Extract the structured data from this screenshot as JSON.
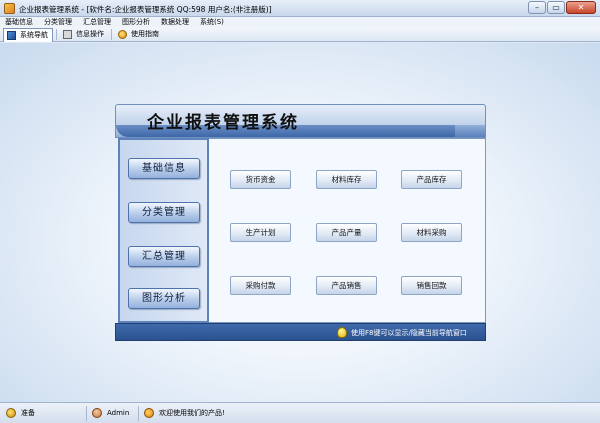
{
  "window": {
    "title": "企业报表管理系统 - [软件名:企业报表管理系统 QQ:598 用户名:(非注册版)]",
    "minimize_glyph": "–",
    "restore_glyph": "▭",
    "close_glyph": "✕"
  },
  "menubar": {
    "items": [
      "基础信息",
      "分类管理",
      "汇总管理",
      "图形分析",
      "数据处理",
      "系统(S)"
    ]
  },
  "toolbar": {
    "tabs": [
      {
        "label": "系统导航",
        "icon": "navigation-icon"
      },
      {
        "label": "信息操作",
        "icon": "info-operation-icon"
      },
      {
        "label": "使用指南",
        "icon": "guide-icon"
      }
    ]
  },
  "panel": {
    "title": "企业报表管理系统",
    "side_menu": [
      "基础信息",
      "分类管理",
      "汇总管理",
      "图形分析"
    ],
    "functions": [
      [
        "货币资金",
        "材料库存",
        "产品库存"
      ],
      [
        "生产计划",
        "产品产量",
        "材料采购"
      ],
      [
        "采购付款",
        "产品销售",
        "销售回款"
      ]
    ],
    "footer_hint": "使用F8键可以显示/隐藏当前导航窗口"
  },
  "statusbar": {
    "ready": "准备",
    "user": "Admin",
    "welcome": "欢迎使用我们的产品!"
  },
  "colors": {
    "accent": "#3d67a8",
    "footer": "#2b528f"
  }
}
